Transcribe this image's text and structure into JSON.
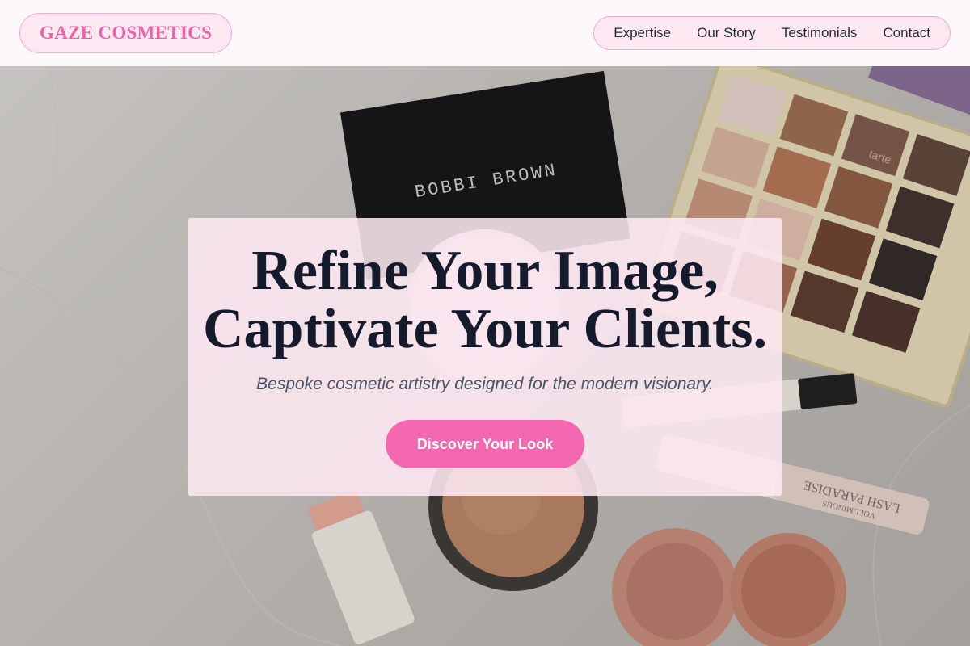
{
  "brand": {
    "name": "GAZE COSMETICS",
    "color": "#f062a8"
  },
  "nav": {
    "items": [
      {
        "label": "Expertise"
      },
      {
        "label": "Our Story"
      },
      {
        "label": "Testimonials"
      },
      {
        "label": "Contact"
      }
    ]
  },
  "hero": {
    "headline_line1": "Refine Your Image,",
    "headline_line2": "Captivate Your Clients.",
    "subtitle": "Bespoke cosmetic artistry designed for the modern visionary.",
    "cta_label": "Discover Your Look",
    "cta_color": "#f367b0",
    "photo_texts": {
      "compact_brand": "BOBBI BROWN",
      "mascara_text": "LASH PARADISE",
      "mascara_subtext": "VOLUMINOUS",
      "palette_mark": "tarte"
    }
  }
}
